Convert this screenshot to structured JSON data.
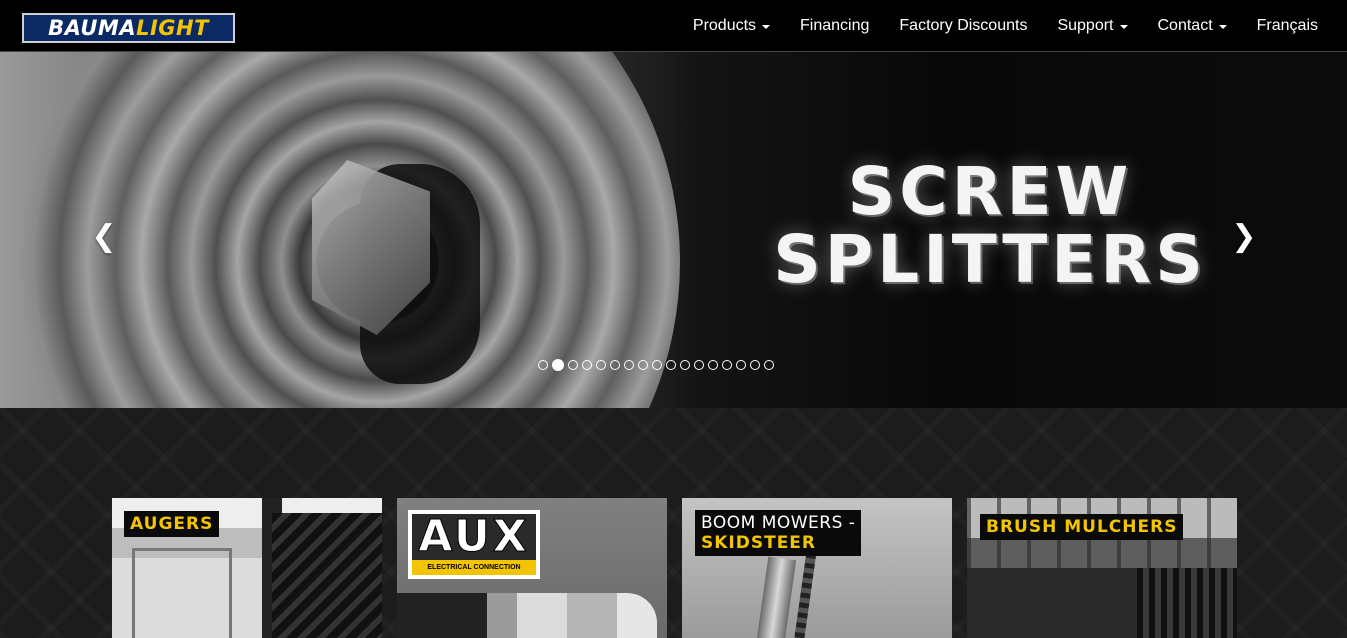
{
  "brand": {
    "logo_part1": "BAUMA",
    "logo_part2": "LIGHT"
  },
  "nav": {
    "items": [
      {
        "label": "Products",
        "dropdown": true
      },
      {
        "label": "Financing",
        "dropdown": false
      },
      {
        "label": "Factory Discounts",
        "dropdown": false
      },
      {
        "label": "Support",
        "dropdown": true
      },
      {
        "label": "Contact",
        "dropdown": true
      },
      {
        "label": "Français",
        "dropdown": false
      }
    ]
  },
  "hero": {
    "title_line1": "SCREW",
    "title_line2": "SPLITTERS",
    "prev_icon": "chevron-left-icon",
    "next_icon": "chevron-right-icon",
    "slide_count": 17,
    "active_slide": 2
  },
  "cards": {
    "augers": {
      "label": "AUGERS"
    },
    "aux": {
      "logo_text": "AUX",
      "logo_sub": "ELECTRICAL CONNECTION"
    },
    "boom": {
      "label_line1": "BOOM MOWERS -",
      "label_line2": "SKIDSTEER"
    },
    "brush": {
      "label": "BRUSH MULCHERS"
    }
  },
  "colors": {
    "accent": "#f2c500",
    "nav_bg": "#000000",
    "logo_bg": "#0b2a63"
  }
}
